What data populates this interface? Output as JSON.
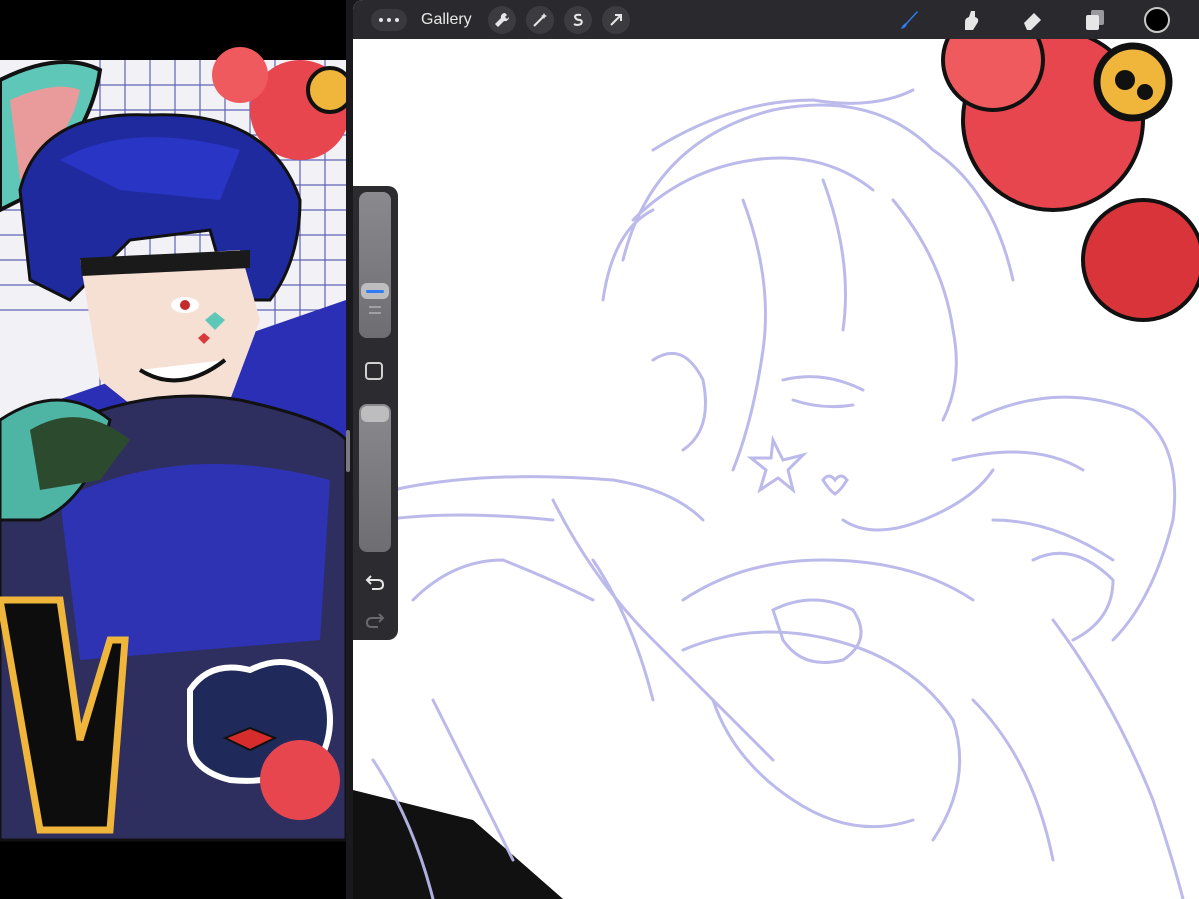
{
  "toolbar": {
    "gallery_label": "Gallery",
    "icons": [
      "more-icon",
      "wrench-icon",
      "magic-wand-icon",
      "selection-icon",
      "transform-arrow-icon",
      "brush-icon",
      "smudge-icon",
      "eraser-icon",
      "layers-icon",
      "color-icon"
    ],
    "active_tool": "brush",
    "active_color": "#000000"
  },
  "sidebar": {
    "controls": [
      "brush-size-slider",
      "modify-button",
      "opacity-slider",
      "undo-button",
      "redo-button"
    ]
  },
  "colors": {
    "toolbar_bg": "#2a2a2e",
    "accent": "#2f7cf6",
    "sketch_stroke": "#b9b7ea"
  }
}
